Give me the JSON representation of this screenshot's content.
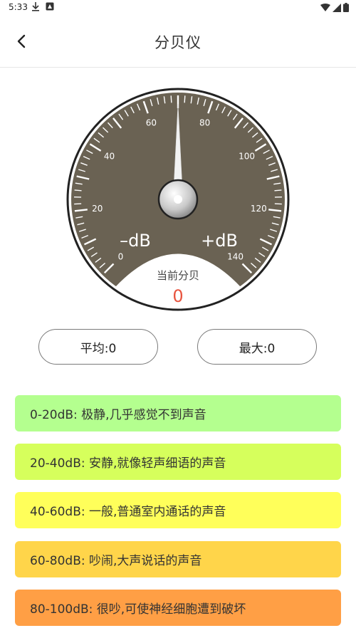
{
  "status_bar": {
    "time": "5:33",
    "left_icons": [
      "download-icon",
      "notification-icon"
    ],
    "right_icons": [
      "wifi-icon",
      "signal-icon",
      "battery-icon"
    ]
  },
  "header": {
    "title": "分贝仪",
    "back_icon": "chevron-left-icon"
  },
  "gauge": {
    "tick_labels": [
      "0",
      "20",
      "40",
      "60",
      "80",
      "100",
      "120",
      "140"
    ],
    "minus_label": "–dB",
    "plus_label": "+dB",
    "current_label": "当前分贝",
    "current_value": "0",
    "needle_value": 70,
    "dial_color": "#6a6253",
    "value_color": "#e8543f"
  },
  "stats": {
    "average": "平均:0",
    "max": "最大:0"
  },
  "levels": [
    {
      "text": "0-20dB: 极静,几乎感觉不到声音",
      "color": "#b4ff8f"
    },
    {
      "text": "20-40dB: 安静,就像轻声细语的声音",
      "color": "#d6ff5c"
    },
    {
      "text": "40-60dB: 一般,普通室内通话的声音",
      "color": "#ffff5a"
    },
    {
      "text": "60-80dB: 吵闹,大声说话的声音",
      "color": "#ffd54a"
    },
    {
      "text": "80-100dB: 很吵,可使神经细胞遭到破坏",
      "color": "#ff9f45"
    }
  ]
}
